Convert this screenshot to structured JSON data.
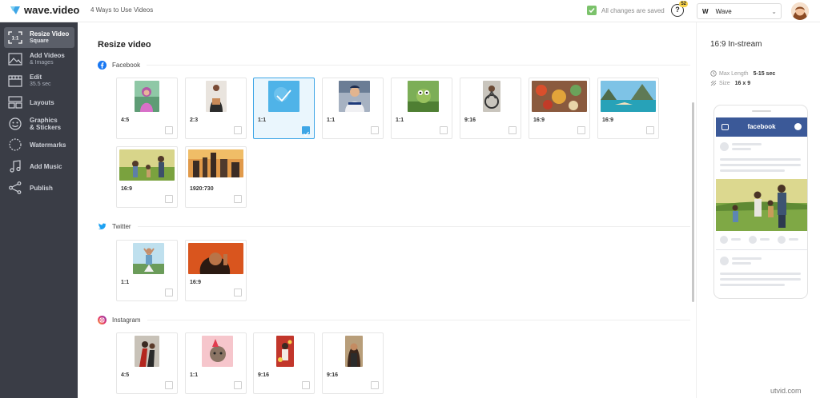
{
  "app": {
    "logo_text": "wave.video",
    "project_title": "4 Ways to Use Videos",
    "save_status": "All changes are saved",
    "help_badge": "52",
    "help_label": "?",
    "workspace_initial": "W",
    "workspace_name": "Wave"
  },
  "sidebar": {
    "items": [
      {
        "label": "Resize Video",
        "sub": "Square",
        "icon": "resize-icon",
        "active": true
      },
      {
        "label": "Add Videos",
        "sub": "& Images",
        "icon": "image-icon"
      },
      {
        "label": "Edit",
        "sub": "35.5 sec",
        "icon": "edit-icon"
      },
      {
        "label": "Layouts",
        "sub": "",
        "icon": "layouts-icon"
      },
      {
        "label": "Graphics",
        "sub": "& Stickers",
        "icon": "sticker-icon"
      },
      {
        "label": "Watermarks",
        "sub": "",
        "icon": "watermark-icon"
      },
      {
        "label": "Add Music",
        "sub": "",
        "icon": "music-icon"
      },
      {
        "label": "Publish",
        "sub": "",
        "icon": "share-icon"
      }
    ]
  },
  "main": {
    "title": "Resize video",
    "sections": [
      {
        "name": "Facebook",
        "icon": "facebook-icon",
        "formats": [
          {
            "ratio": "4:5"
          },
          {
            "ratio": "2:3"
          },
          {
            "ratio": "1:1",
            "selected": true
          },
          {
            "ratio": "1:1"
          },
          {
            "ratio": "1:1"
          },
          {
            "ratio": "9:16"
          },
          {
            "ratio": "16:9"
          },
          {
            "ratio": "16:9"
          },
          {
            "ratio": "16:9"
          },
          {
            "ratio": "1920:730"
          }
        ]
      },
      {
        "name": "Twitter",
        "icon": "twitter-icon",
        "formats": [
          {
            "ratio": "1:1"
          },
          {
            "ratio": "16:9"
          }
        ]
      },
      {
        "name": "Instagram",
        "icon": "instagram-icon",
        "formats": [
          {
            "ratio": "4:5"
          },
          {
            "ratio": "1:1"
          },
          {
            "ratio": "9:16"
          },
          {
            "ratio": "9:16"
          }
        ]
      }
    ]
  },
  "preview": {
    "title": "16:9 In-stream",
    "max_length_label": "Max Length",
    "max_length_value": "5-15 sec",
    "size_label": "Size",
    "size_value": "16 x 9",
    "phone_header": "facebook"
  },
  "watermark": "utvid.com",
  "colors": {
    "sidebar_bg": "#3a3d46",
    "accent": "#3ea6e6",
    "facebook": "#3b5998",
    "saved_green": "#7bc26b"
  }
}
